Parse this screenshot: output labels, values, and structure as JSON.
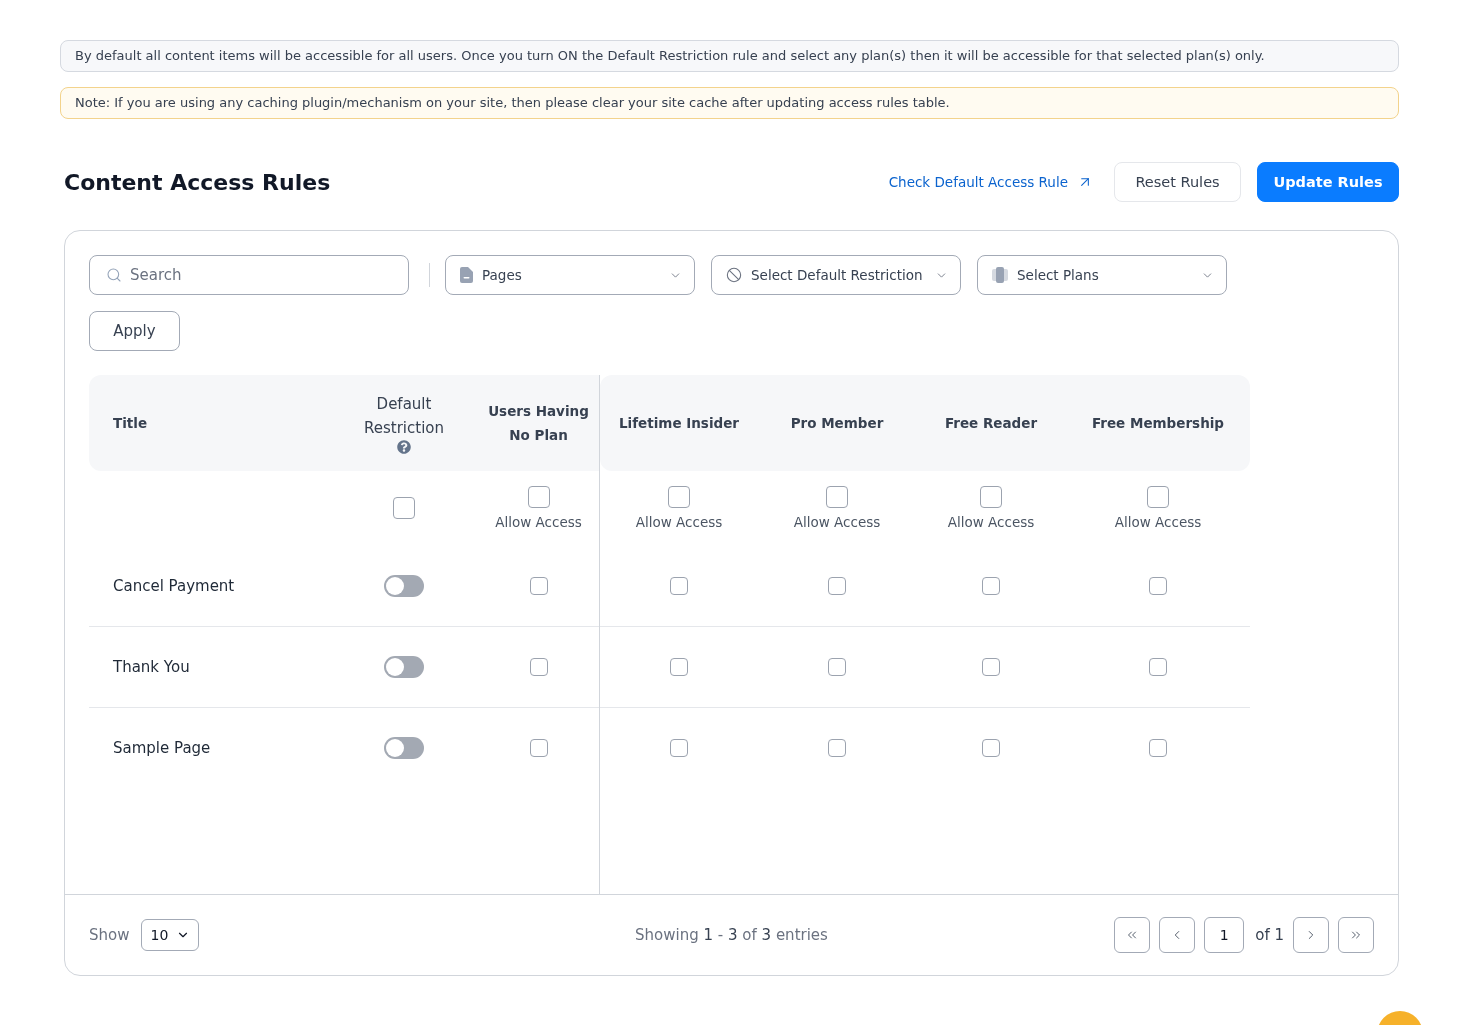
{
  "notices": [
    {
      "kind": "info",
      "text": "By default all content items will be accessible for all users. Once you turn ON the Default Restriction rule and select any plan(s) then it will be accessible for that selected plan(s) only."
    },
    {
      "kind": "warning",
      "text": "Note: If you are using any caching plugin/mechanism on your site, then please clear your site cache after updating access rules table."
    }
  ],
  "header": {
    "title": "Content Access Rules",
    "link": "Check Default Access Rule",
    "buttons": [
      {
        "kind": "secondary",
        "label": "Reset Rules"
      },
      {
        "kind": "primary",
        "label": "Update Rules"
      }
    ]
  },
  "filters": {
    "search": {
      "placeholder": "Search"
    },
    "dropdowns": [
      {
        "kind": "pages",
        "label": "Pages"
      },
      {
        "kind": "restriction",
        "label": "Select Default Restriction"
      },
      {
        "kind": "plans",
        "label": "Select Plans"
      }
    ],
    "apply": "Apply"
  },
  "table": {
    "columns": {
      "title": "Title",
      "default_restriction": "Default Restriction",
      "no_plan": "Users Having No Plan",
      "plans": [
        "Lifetime Insider",
        "Pro Member",
        "Free Reader",
        "Free Membership"
      ]
    },
    "bulk_row": {
      "default_restriction": {
        "checked": false
      },
      "no_plan": {
        "label": "Allow Access",
        "checked": false
      },
      "plans": [
        {
          "label": "Allow Access",
          "checked": false
        },
        {
          "label": "Allow Access",
          "checked": false
        },
        {
          "label": "Allow Access",
          "checked": false
        },
        {
          "label": "Allow Access",
          "checked": false
        }
      ]
    },
    "rows": [
      {
        "title": "Cancel Payment",
        "restricted": false,
        "no_plan": {
          "checked": false
        },
        "plans": [
          {
            "checked": false
          },
          {
            "checked": false
          },
          {
            "checked": false
          },
          {
            "checked": false
          }
        ]
      },
      {
        "title": "Thank You",
        "restricted": false,
        "no_plan": {
          "checked": false
        },
        "plans": [
          {
            "checked": false
          },
          {
            "checked": false
          },
          {
            "checked": false
          },
          {
            "checked": false
          }
        ]
      },
      {
        "title": "Sample Page",
        "restricted": false,
        "no_plan": {
          "checked": false
        },
        "plans": [
          {
            "checked": false
          },
          {
            "checked": false
          },
          {
            "checked": false
          },
          {
            "checked": false
          }
        ]
      }
    ]
  },
  "footer": {
    "show_label": "Show",
    "page_size": "10",
    "summary": "Showing **1** - **3** of **3** entries",
    "page": "1",
    "page_count": "of 1"
  }
}
